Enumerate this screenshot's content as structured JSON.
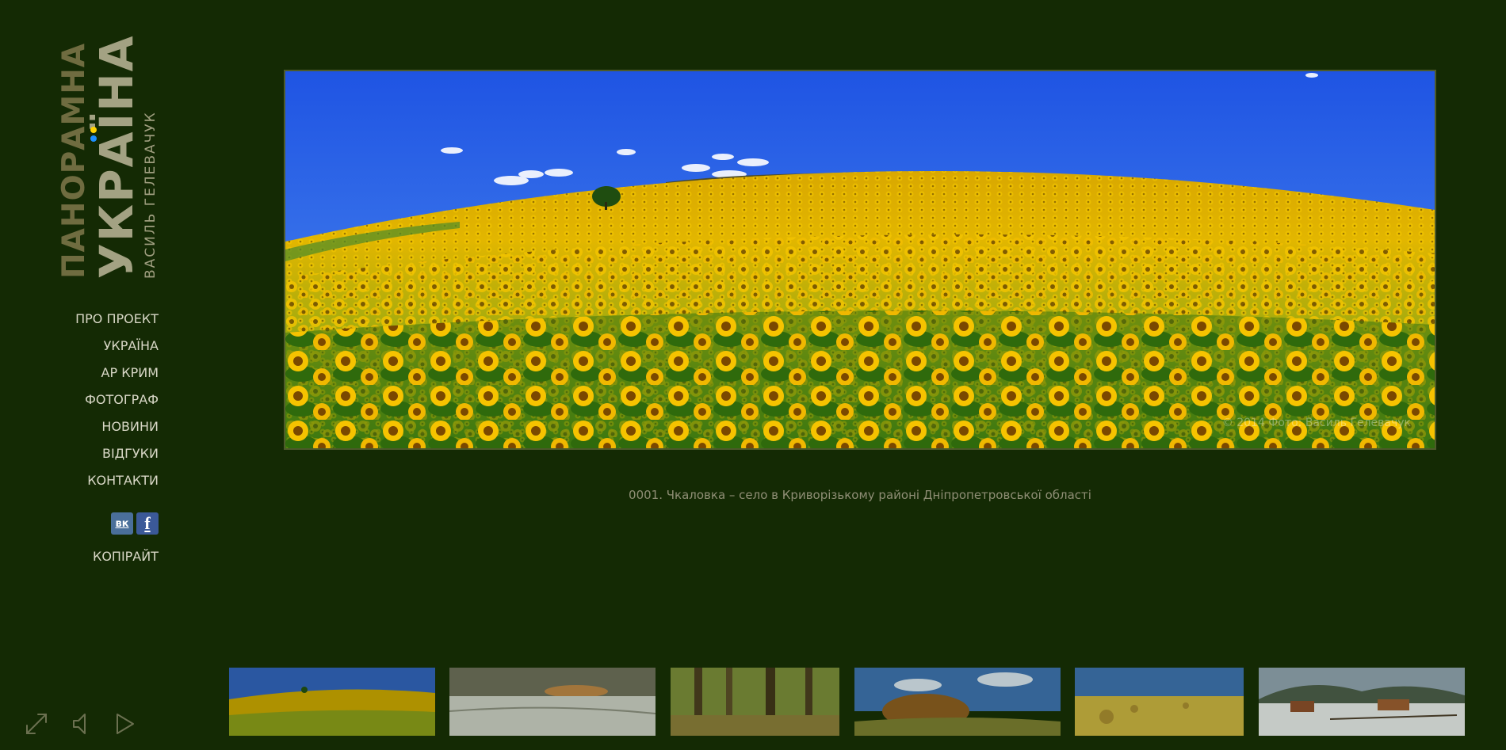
{
  "logo": {
    "line1": "ПАНОРАМНА",
    "line2": "УКРАЇНА",
    "author": "ВАСИЛЬ ГЕЛЕВАЧУК",
    "flag_colors": [
      "#ffd400",
      "#1e90ff"
    ]
  },
  "nav": {
    "items": [
      {
        "label": "ПРО ПРОЕКТ"
      },
      {
        "label": "УКРАЇНА"
      },
      {
        "label": "АР КРИМ"
      },
      {
        "label": "ФОТОГРАФ"
      },
      {
        "label": "НОВИНИ"
      },
      {
        "label": "ВІДГУКИ"
      },
      {
        "label": "КОНТАКТИ"
      }
    ]
  },
  "social": {
    "vk_label": "вк",
    "fb_label": "f",
    "icons": [
      "vk-icon",
      "facebook-icon"
    ]
  },
  "copyright_label": "КОПІРАЙТ",
  "photo": {
    "watermark": "© 2014 Фото: Василь Гелевачук",
    "caption": "0001. Чкаловка – село в Криворізькому районі Дніпропетровської області"
  },
  "thumbnails": [
    {
      "subject": "sunflower field"
    },
    {
      "subject": "winter sunset"
    },
    {
      "subject": "forest"
    },
    {
      "subject": "autumn trees"
    },
    {
      "subject": "hay bales field"
    },
    {
      "subject": "snowy village"
    }
  ],
  "controls": {
    "icons": [
      "fullscreen-icon",
      "volume-icon",
      "play-icon"
    ]
  },
  "colors": {
    "background": "#142a04",
    "nav_text": "#d8d7c6",
    "caption_text": "#8f8e75"
  }
}
